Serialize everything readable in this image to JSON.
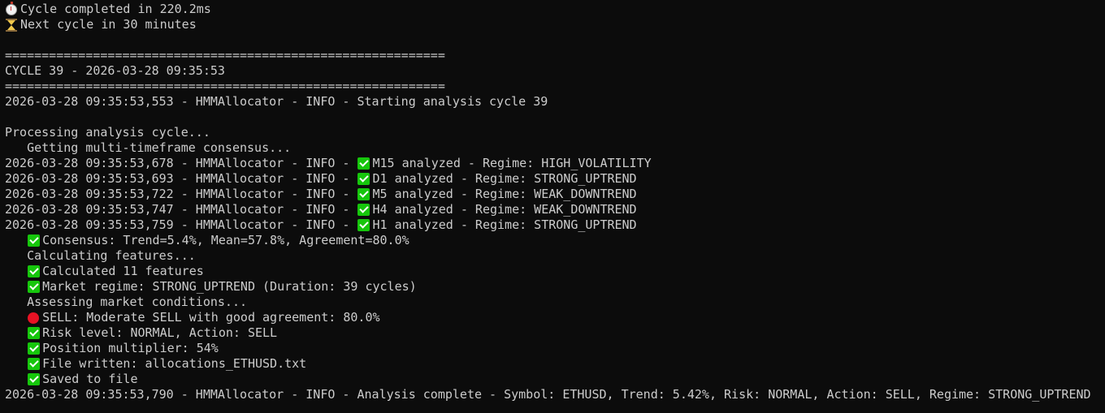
{
  "lines": [
    {
      "segments": [
        {
          "icon": "stopwatch-icon"
        },
        {
          "text": "Cycle completed in 220.2ms"
        }
      ]
    },
    {
      "segments": [
        {
          "icon": "hourglass-icon"
        },
        {
          "text": "Next cycle in 30 minutes"
        }
      ]
    },
    {
      "segments": [
        {
          "text": ""
        }
      ]
    },
    {
      "segments": [
        {
          "text": "============================================================"
        }
      ]
    },
    {
      "segments": [
        {
          "text": "CYCLE 39 - 2026-03-28 09:35:53"
        }
      ]
    },
    {
      "segments": [
        {
          "text": "============================================================"
        }
      ]
    },
    {
      "segments": [
        {
          "text": "2026-03-28 09:35:53,553 - HMMAllocator - INFO - Starting analysis cycle 39"
        }
      ]
    },
    {
      "segments": [
        {
          "text": ""
        }
      ]
    },
    {
      "segments": [
        {
          "text": "Processing analysis cycle..."
        }
      ]
    },
    {
      "segments": [
        {
          "text": "   Getting multi-timeframe consensus..."
        }
      ]
    },
    {
      "segments": [
        {
          "text": "2026-03-28 09:35:53,678 - HMMAllocator - INFO - "
        },
        {
          "icon": "check-mark-icon"
        },
        {
          "text": "M15 analyzed - Regime: HIGH_VOLATILITY"
        }
      ]
    },
    {
      "segments": [
        {
          "text": "2026-03-28 09:35:53,693 - HMMAllocator - INFO - "
        },
        {
          "icon": "check-mark-icon"
        },
        {
          "text": "D1 analyzed - Regime: STRONG_UPTREND"
        }
      ]
    },
    {
      "segments": [
        {
          "text": "2026-03-28 09:35:53,722 - HMMAllocator - INFO - "
        },
        {
          "icon": "check-mark-icon"
        },
        {
          "text": "M5 analyzed - Regime: WEAK_DOWNTREND"
        }
      ]
    },
    {
      "segments": [
        {
          "text": "2026-03-28 09:35:53,747 - HMMAllocator - INFO - "
        },
        {
          "icon": "check-mark-icon"
        },
        {
          "text": "H4 analyzed - Regime: WEAK_DOWNTREND"
        }
      ]
    },
    {
      "segments": [
        {
          "text": "2026-03-28 09:35:53,759 - HMMAllocator - INFO - "
        },
        {
          "icon": "check-mark-icon"
        },
        {
          "text": "H1 analyzed - Regime: STRONG_UPTREND"
        }
      ]
    },
    {
      "segments": [
        {
          "text": "   "
        },
        {
          "icon": "check-mark-icon"
        },
        {
          "text": "Consensus: Trend=5.4%, Mean=57.8%, Agreement=80.0%"
        }
      ]
    },
    {
      "segments": [
        {
          "text": "   Calculating features..."
        }
      ]
    },
    {
      "segments": [
        {
          "text": "   "
        },
        {
          "icon": "check-mark-icon"
        },
        {
          "text": "Calculated 11 features"
        }
      ]
    },
    {
      "segments": [
        {
          "text": "   "
        },
        {
          "icon": "check-mark-icon"
        },
        {
          "text": "Market regime: STRONG_UPTREND (Duration: 39 cycles)"
        }
      ]
    },
    {
      "segments": [
        {
          "text": "   Assessing market conditions..."
        }
      ]
    },
    {
      "segments": [
        {
          "text": "   "
        },
        {
          "icon": "red-circle-icon"
        },
        {
          "text": "SELL: Moderate SELL with good agreement: 80.0%"
        }
      ]
    },
    {
      "segments": [
        {
          "text": "   "
        },
        {
          "icon": "check-mark-icon"
        },
        {
          "text": "Risk level: NORMAL, Action: SELL"
        }
      ]
    },
    {
      "segments": [
        {
          "text": "   "
        },
        {
          "icon": "check-mark-icon"
        },
        {
          "text": "Position multiplier: 54%"
        }
      ]
    },
    {
      "segments": [
        {
          "text": "   "
        },
        {
          "icon": "check-mark-icon"
        },
        {
          "text": "File written: allocations_ETHUSD.txt"
        }
      ]
    },
    {
      "segments": [
        {
          "text": "   "
        },
        {
          "icon": "check-mark-icon"
        },
        {
          "text": "Saved to file"
        }
      ]
    },
    {
      "segments": [
        {
          "text": "2026-03-28 09:35:53,790 - HMMAllocator - INFO - Analysis complete - Symbol: ETHUSD, Trend: 5.42%, Risk: NORMAL, Action: SELL, Regime: STRONG_UPTREND"
        }
      ]
    }
  ],
  "colors": {
    "background": "#0c0c0c",
    "text": "#cccccc",
    "check": "#16c60c",
    "alert": "#e81224"
  }
}
